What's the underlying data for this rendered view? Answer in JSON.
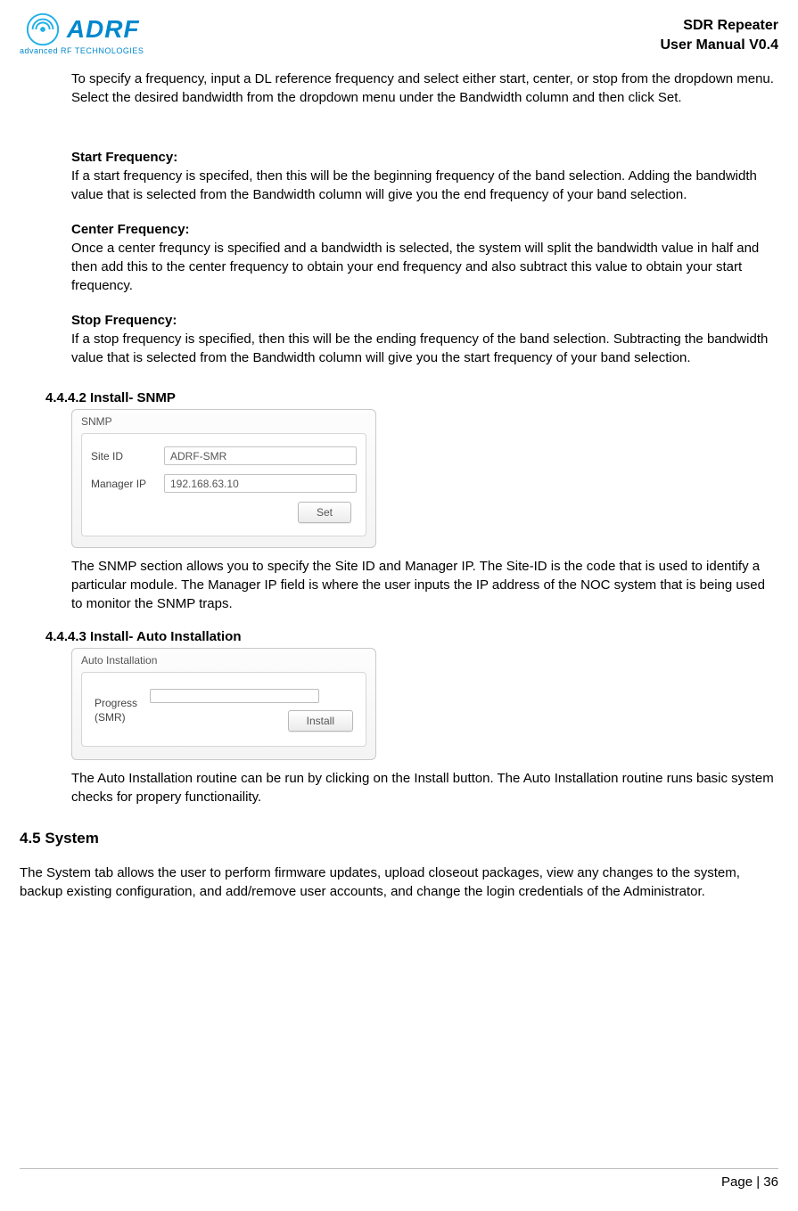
{
  "header": {
    "logo_text": "ADRF",
    "logo_tagline": "advanced RF TECHNOLOGIES",
    "title_line1": "SDR Repeater",
    "title_line2": "User Manual V0.4"
  },
  "intro_para": "To specify a frequency, input a DL reference frequency and select either start, center, or stop from the dropdown menu.   Select the desired bandwidth from the dropdown menu under the Bandwidth column and then click Set.",
  "defs": {
    "start": {
      "label": "Start Frequency:",
      "body": "If a start frequency is specifed, then this will be the beginning frequency of the band selection.   Adding the bandwidth value that is selected from the Bandwidth column will give you the end frequency of your band selection."
    },
    "center": {
      "label": "Center Frequency:",
      "body": "Once a center frequncy is specified and a bandwidth is selected, the system will split the bandwidth value in half and then add this to the center frequency to obtain your end frequency and also subtract this value to obtain your start frequency."
    },
    "stop": {
      "label": "Stop Frequency:",
      "body": "If a stop frequency is specified, then this will be the ending frequency of the band selection.   Subtracting the bandwidth value that is selected from the Bandwidth column will give you the start frequency of your band selection."
    }
  },
  "snmp": {
    "heading": "4.4.4.2 Install- SNMP",
    "panel_title": "SNMP",
    "site_id_label": "Site ID",
    "site_id_value": "ADRF-SMR",
    "manager_ip_label": "Manager IP",
    "manager_ip_value": "192.168.63.10",
    "set_button": "Set",
    "para": "The SNMP section allows you to specify the Site ID and Manager IP.   The Site-ID is the code that is used to identify a particular module.   The Manager IP field is where the user inputs the IP address of the NOC system that is being used to monitor the SNMP traps."
  },
  "auto": {
    "heading": "4.4.4.3 Install- Auto Installation",
    "panel_title": "Auto Installation",
    "progress_label_line1": "Progress",
    "progress_label_line2": "(SMR)",
    "install_button": "Install",
    "para": "The Auto Installation routine can be run by clicking on the Install button.   The Auto Installation routine runs basic system checks for propery functionaility."
  },
  "system": {
    "heading": "4.5 System",
    "para": "The System tab allows the user to perform firmware updates, upload closeout packages, view any changes to the system, backup existing configuration, and add/remove user accounts, and change the login credentials of the Administrator."
  },
  "footer": {
    "page": "Page | 36"
  }
}
